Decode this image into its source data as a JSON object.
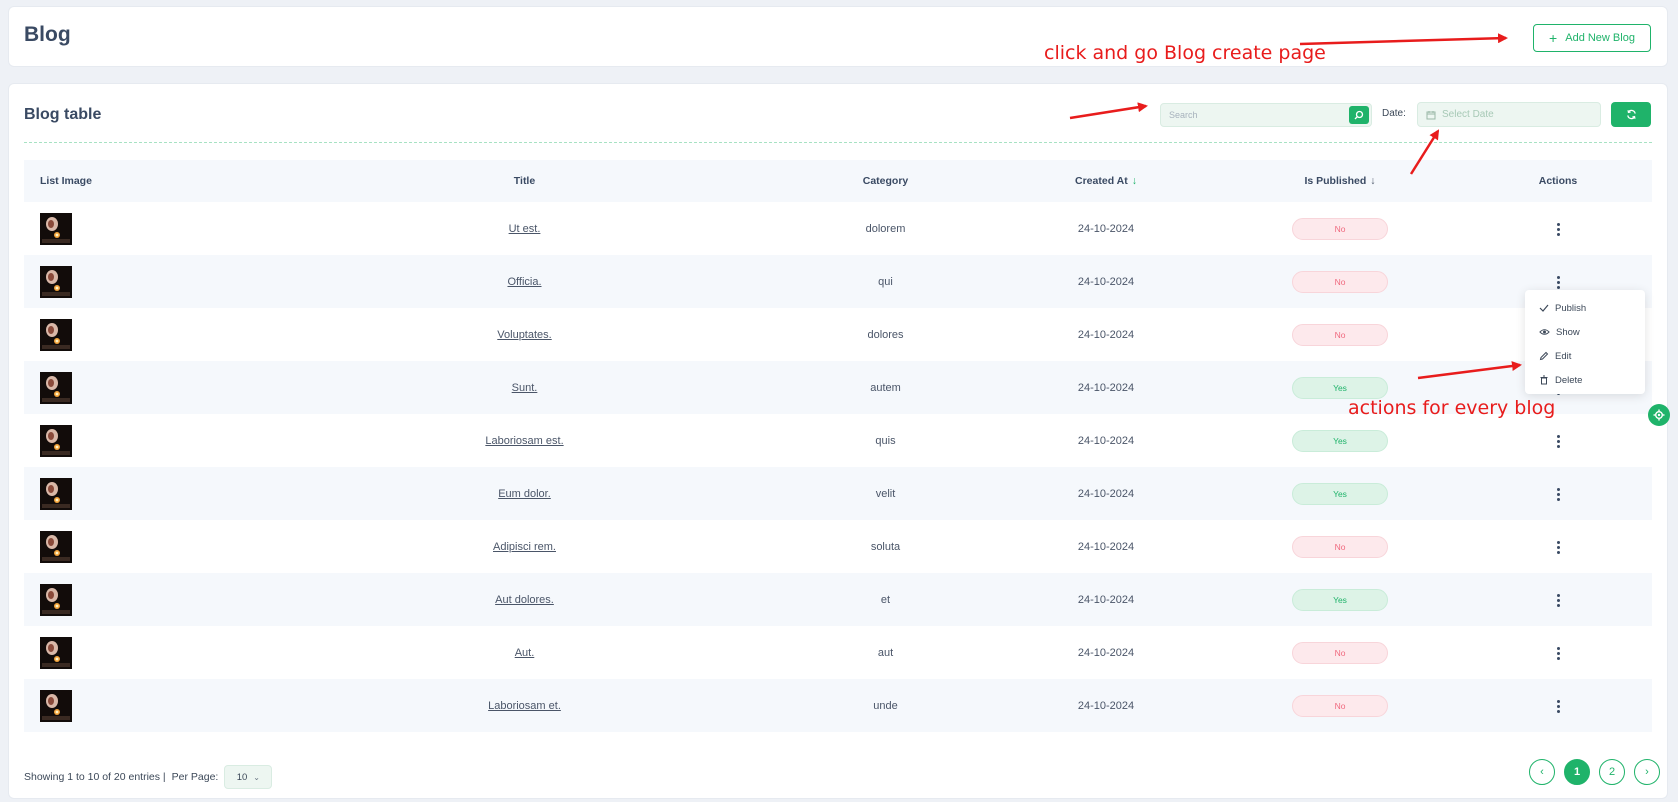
{
  "header": {
    "title": "Blog",
    "add_button_label": "Add New Blog",
    "add_icon": "plus-icon"
  },
  "table_card": {
    "title": "Blog table",
    "search": {
      "placeholder": "Search",
      "value": ""
    },
    "date_label": "Date:",
    "date_placeholder": "Select Date"
  },
  "columns": {
    "image": "List Image",
    "title": "Title",
    "category": "Category",
    "created_at": "Created At",
    "is_published": "Is Published",
    "actions": "Actions"
  },
  "rows": [
    {
      "title": "Ut est.",
      "category": "dolorem",
      "created": "24-10-2024",
      "published": "No"
    },
    {
      "title": "Officia.",
      "category": "qui",
      "created": "24-10-2024",
      "published": "No"
    },
    {
      "title": "Voluptates.",
      "category": "dolores",
      "created": "24-10-2024",
      "published": "No"
    },
    {
      "title": "Sunt.",
      "category": "autem",
      "created": "24-10-2024",
      "published": "Yes"
    },
    {
      "title": "Laboriosam est.",
      "category": "quis",
      "created": "24-10-2024",
      "published": "Yes"
    },
    {
      "title": "Eum dolor.",
      "category": "velit",
      "created": "24-10-2024",
      "published": "Yes"
    },
    {
      "title": "Adipisci rem.",
      "category": "soluta",
      "created": "24-10-2024",
      "published": "No"
    },
    {
      "title": "Aut dolores.",
      "category": "et",
      "created": "24-10-2024",
      "published": "Yes"
    },
    {
      "title": "Aut.",
      "category": "aut",
      "created": "24-10-2024",
      "published": "No"
    },
    {
      "title": "Laboriosam et.",
      "category": "unde",
      "created": "24-10-2024",
      "published": "No"
    }
  ],
  "action_menu": {
    "items": [
      {
        "label": "Publish",
        "icon": "check-icon"
      },
      {
        "label": "Show",
        "icon": "eye-icon"
      },
      {
        "label": "Edit",
        "icon": "pencil-icon"
      },
      {
        "label": "Delete",
        "icon": "trash-icon"
      }
    ]
  },
  "footer": {
    "showing": "Showing 1 to 10 of 20 entries |",
    "per_page_label": "Per Page:",
    "per_page_value": "10",
    "pages": [
      "1",
      "2"
    ],
    "current_page": "1"
  },
  "annotations": {
    "create": "click and go Blog create page",
    "actions": "actions for every blog"
  },
  "colors": {
    "accent": "#1fb36a",
    "no_badge": "#f06a7f",
    "annotation": "#e81c1c"
  }
}
